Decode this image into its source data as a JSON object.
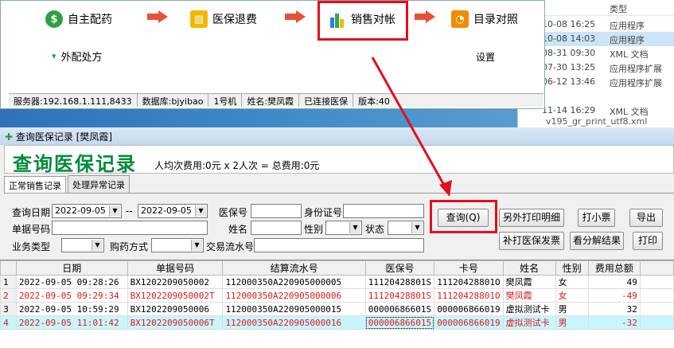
{
  "top_app": {
    "tools": [
      {
        "label": "自主配药",
        "icon": "dollar-icon"
      },
      {
        "label": "医保退费",
        "icon": "ladder-icon"
      },
      {
        "label": "销售对帐",
        "icon": "bar-chart-icon"
      },
      {
        "label": "目录对照",
        "icon": "rss-icon"
      }
    ],
    "external_rx": "外配处方",
    "settings": "设置",
    "status": [
      "服务器:192.168.1.111,8433",
      "数据库:bjyibao",
      "1号机",
      "姓名:樊凤霞",
      "已连接医保",
      "版本:40"
    ]
  },
  "explorer": {
    "header_type": "类型",
    "rows": [
      {
        "date": "10-08 16:25",
        "type": "应用程序"
      },
      {
        "date": "10-08 14:03",
        "type": "应用程序"
      },
      {
        "date": "08-31 09:30",
        "type": "XML 文档"
      },
      {
        "date": "07-30 13:25",
        "type": "应用程序扩展"
      },
      {
        "date": "06-12 13:46",
        "type": "应用程序扩展"
      },
      {
        "date": "11-14 16:29",
        "type": "XML 文档"
      }
    ],
    "cut_name": "v195_gr_print_utf8.xml"
  },
  "window": {
    "title": "查询医保记录 [樊凤霞]",
    "heading": "查询医保记录",
    "summary": "人均次费用:0元 x 2人次 = 总费用:0元",
    "tabs": [
      "正常销售记录",
      "处理异常记录"
    ]
  },
  "form": {
    "query_date_label": "查询日期",
    "date_from": "2022-09-05",
    "date_sep": "--",
    "date_to": "2022-09-05",
    "insurance_no_label": "医保号",
    "id_no_label": "身份证号",
    "doc_no_label": "单据号码",
    "name_label": "姓名",
    "gender_label": "性别",
    "status_label": "状态",
    "biz_type_label": "业务类型",
    "buy_method_label": "购药方式",
    "txn_no_label": "交易流水号"
  },
  "buttons": {
    "query": "查询(Q)",
    "print_detail": "另外打印明细",
    "print_small": "打小票",
    "export": "导出",
    "reprint": "补打医保发票",
    "view_result": "看分解结果",
    "print": "打印"
  },
  "table": {
    "columns": [
      "",
      "日期",
      "单据号码",
      "结算流水号",
      "医保号",
      "卡号",
      "姓名",
      "性别",
      "费用总额"
    ],
    "rows": [
      {
        "n": "1",
        "date": "2022-09-05 09:28:26",
        "doc": "BX1202209050002",
        "txn": "112000350A220905000005",
        "ins": "11120428801S",
        "card": "11120428801O",
        "name": "樊凤霞",
        "gender": "女",
        "total": "49",
        "red": false
      },
      {
        "n": "2",
        "date": "2022-09-05 09:29:34",
        "doc": "BX1202209050002T",
        "txn": "112000350A220905000006",
        "ins": "11120428801S",
        "card": "11120428801O",
        "name": "樊凤霞",
        "gender": "女",
        "total": "-49",
        "red": true
      },
      {
        "n": "3",
        "date": "2022-09-05 10:59:29",
        "doc": "BX1202209050006",
        "txn": "112000350A220905000015",
        "ins": "00000686601S",
        "card": "000006866019",
        "name": "虚拟测试卡",
        "gender": "男",
        "total": "32",
        "red": false
      },
      {
        "n": "4",
        "date": "2022-09-05 11:01:42",
        "doc": "BX1202209050006T",
        "txn": "112000350A220905000016",
        "ins": "000006866015",
        "card": "000006866019",
        "name": "虚拟测试卡",
        "gender": "男",
        "total": "-32",
        "red": true,
        "sel": true
      }
    ]
  },
  "colors": {
    "heading": "#008a3a",
    "annotation": "#e0101c"
  }
}
